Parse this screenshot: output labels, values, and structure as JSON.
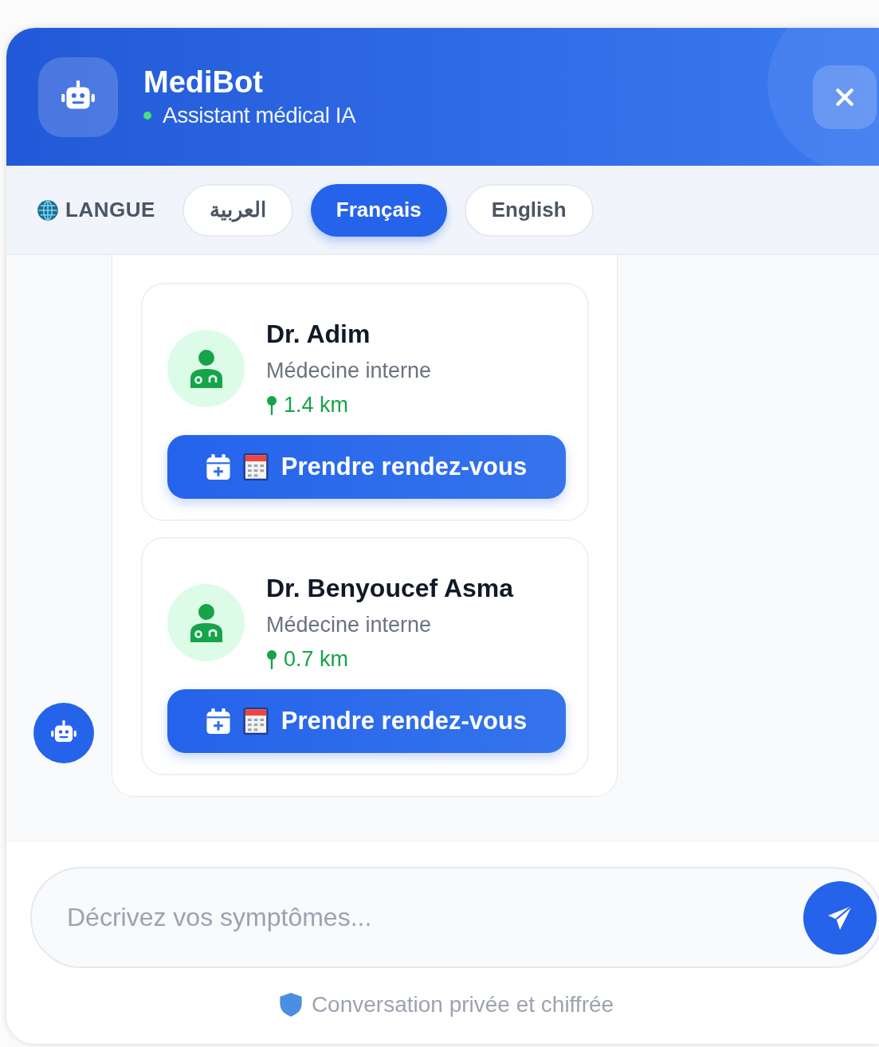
{
  "header": {
    "title": "MediBot",
    "status": "Assistant médical IA",
    "online": true
  },
  "language": {
    "label": "LANGUE",
    "options": [
      {
        "label": "العربية",
        "selected": false
      },
      {
        "label": "Français",
        "selected": true
      },
      {
        "label": "English",
        "selected": false
      }
    ]
  },
  "message": {
    "doctors": [
      {
        "name": "Dr. Adim",
        "specialty": "Médecine interne",
        "distance": "1.4 km",
        "action": "Prendre rendez-vous"
      },
      {
        "name": "Dr. Benyoucef Asma",
        "specialty": "Médecine interne",
        "distance": "0.7 km",
        "action": "Prendre rendez-vous"
      }
    ]
  },
  "composer": {
    "placeholder": "Décrivez vos symptômes..."
  },
  "footer": {
    "note": "Conversation privée et chiffrée"
  }
}
